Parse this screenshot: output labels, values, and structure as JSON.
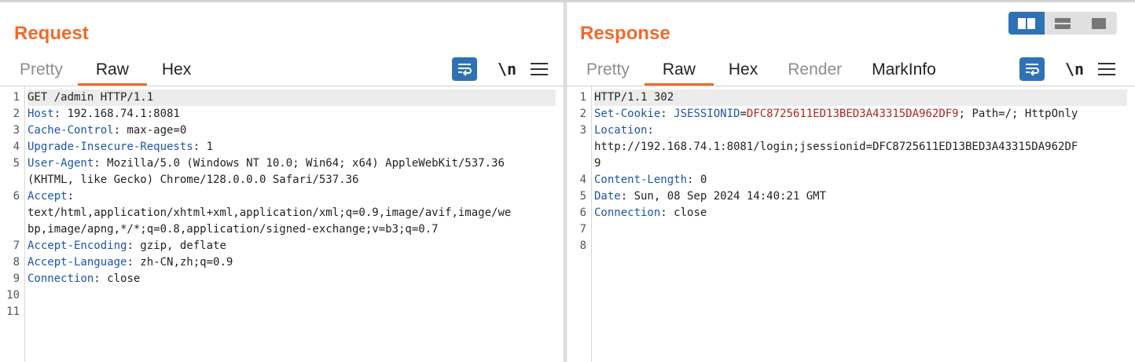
{
  "request": {
    "title": "Request",
    "tabs": [
      "Pretty",
      "Raw",
      "Hex"
    ],
    "active_tab": "Raw",
    "icons": {
      "wrap": "word-wrap-icon",
      "newline": "\\n",
      "menu": "menu-icon"
    },
    "line_numbers": [
      "1",
      "2",
      "3",
      "4",
      "5",
      "6",
      "7",
      "8",
      "9",
      "10",
      "11"
    ],
    "lines": [
      {
        "segments": [
          {
            "text": "GET /admin HTTP/1.1",
            "style": "plain"
          }
        ]
      },
      {
        "segments": [
          {
            "text": "Host",
            "style": "key"
          },
          {
            "text": ": 192.168.74.1:8081",
            "style": "plain"
          }
        ]
      },
      {
        "segments": [
          {
            "text": "Cache-Control",
            "style": "key"
          },
          {
            "text": ": max-age=0",
            "style": "plain"
          }
        ]
      },
      {
        "segments": [
          {
            "text": "Upgrade-Insecure-Requests",
            "style": "key"
          },
          {
            "text": ": 1",
            "style": "plain"
          }
        ]
      },
      {
        "segments": [
          {
            "text": "User-Agent",
            "style": "key"
          },
          {
            "text": ": Mozilla/5.0 (Windows NT 10.0; Win64; x64) AppleWebKit/537.36",
            "style": "plain"
          }
        ]
      },
      {
        "segments": [
          {
            "text": "(KHTML, like Gecko) Chrome/128.0.0.0 Safari/537.36",
            "style": "plain"
          }
        ]
      },
      {
        "segments": [
          {
            "text": "Accept",
            "style": "key"
          },
          {
            "text": ":",
            "style": "plain"
          }
        ]
      },
      {
        "segments": [
          {
            "text": "text/html,application/xhtml+xml,application/xml;q=0.9,image/avif,image/we",
            "style": "plain"
          }
        ]
      },
      {
        "segments": [
          {
            "text": "bp,image/apng,*/*;q=0.8,application/signed-exchange;v=b3;q=0.7",
            "style": "plain"
          }
        ]
      },
      {
        "segments": [
          {
            "text": "Accept-Encoding",
            "style": "key"
          },
          {
            "text": ": gzip, deflate",
            "style": "plain"
          }
        ]
      },
      {
        "segments": [
          {
            "text": "Accept-Language",
            "style": "key"
          },
          {
            "text": ": zh-CN,zh;q=0.9",
            "style": "plain"
          }
        ]
      },
      {
        "segments": [
          {
            "text": "Connection",
            "style": "key"
          },
          {
            "text": ": close",
            "style": "plain"
          }
        ]
      },
      {
        "segments": []
      },
      {
        "segments": []
      }
    ]
  },
  "response": {
    "title": "Response",
    "tabs": [
      "Pretty",
      "Raw",
      "Hex",
      "Render",
      "MarkInfo"
    ],
    "active_tab": "Raw",
    "icons": {
      "wrap": "word-wrap-icon",
      "newline": "\\n",
      "menu": "menu-icon"
    },
    "line_numbers": [
      "1",
      "2",
      "3",
      "",
      "",
      "4",
      "5",
      "6",
      "7",
      "8"
    ],
    "lines": [
      {
        "segments": [
          {
            "text": "HTTP/1.1 302",
            "style": "plain"
          }
        ]
      },
      {
        "segments": [
          {
            "text": "Set-Cookie",
            "style": "key"
          },
          {
            "text": ": ",
            "style": "plain"
          },
          {
            "text": "JSESSIONID",
            "style": "key"
          },
          {
            "text": "=",
            "style": "plain"
          },
          {
            "text": "DFC8725611ED13BED3A43315DA962DF9",
            "style": "red"
          },
          {
            "text": "; Path=/; HttpOnly",
            "style": "plain"
          }
        ]
      },
      {
        "segments": [
          {
            "text": "Location",
            "style": "key"
          },
          {
            "text": ":",
            "style": "plain"
          }
        ]
      },
      {
        "segments": [
          {
            "text": "http://192.168.74.1:8081/login;jsessionid=DFC8725611ED13BED3A43315DA962DF",
            "style": "plain"
          }
        ]
      },
      {
        "segments": [
          {
            "text": "9",
            "style": "plain"
          }
        ]
      },
      {
        "segments": [
          {
            "text": "Content-Length",
            "style": "key"
          },
          {
            "text": ": 0",
            "style": "plain"
          }
        ]
      },
      {
        "segments": [
          {
            "text": "Date",
            "style": "key"
          },
          {
            "text": ": Sun, 08 Sep 2024 14:40:21 GMT",
            "style": "plain"
          }
        ]
      },
      {
        "segments": [
          {
            "text": "Connection",
            "style": "key"
          },
          {
            "text": ": close",
            "style": "plain"
          }
        ]
      },
      {
        "segments": []
      },
      {
        "segments": []
      }
    ]
  },
  "request_gutter_rows": [
    0,
    1,
    2,
    3,
    4,
    6,
    9,
    10,
    11,
    12,
    13
  ],
  "response_gutter_rows": [
    0,
    1,
    2,
    5,
    6,
    7,
    8,
    9
  ],
  "layout_toggle": {
    "options": [
      "side-by-side-icon",
      "horizontal-split-icon",
      "single-pane-icon"
    ],
    "active": "side-by-side-icon"
  },
  "colors": {
    "accent": "#ee6b2d",
    "key": "#1f54a8",
    "value_highlight": "#b0241f",
    "button_blue": "#2e72b5"
  }
}
